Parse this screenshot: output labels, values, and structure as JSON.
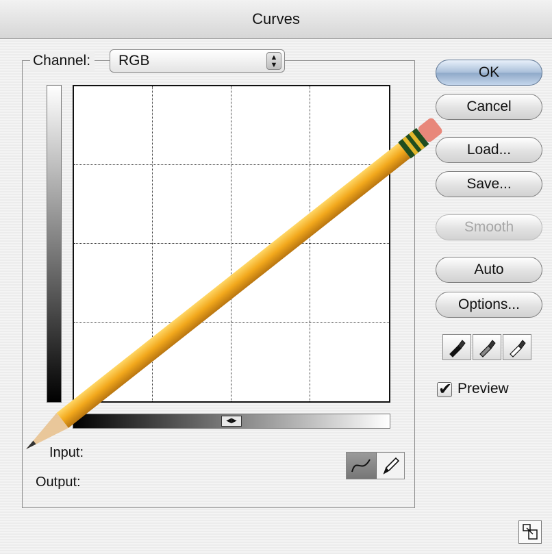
{
  "window": {
    "title": "Curves"
  },
  "channel": {
    "label": "Channel:",
    "value": "RGB",
    "stepper_glyph": "▲▼"
  },
  "curve_area": {
    "gridlines": 4,
    "toggle_glyph": "◀▶"
  },
  "readouts": {
    "input_label": "Input:",
    "output_label": "Output:"
  },
  "tools": {
    "curve_tool_icon": "curve-tool-icon",
    "pencil_tool_icon": "pencil-tool-icon",
    "selected": "curve"
  },
  "buttons": {
    "ok": "OK",
    "cancel": "Cancel",
    "load": "Load...",
    "save": "Save...",
    "smooth": "Smooth",
    "auto": "Auto",
    "options": "Options..."
  },
  "eyedroppers": [
    "black-eyedropper-icon",
    "gray-eyedropper-icon",
    "white-eyedropper-icon"
  ],
  "preview": {
    "label": "Preview",
    "checked": true
  },
  "colors": {
    "default_button": "#a9bfd9",
    "pencil_body": "#f2a81c",
    "pencil_band": "#1f4d1f",
    "eraser": "#e8877a"
  }
}
